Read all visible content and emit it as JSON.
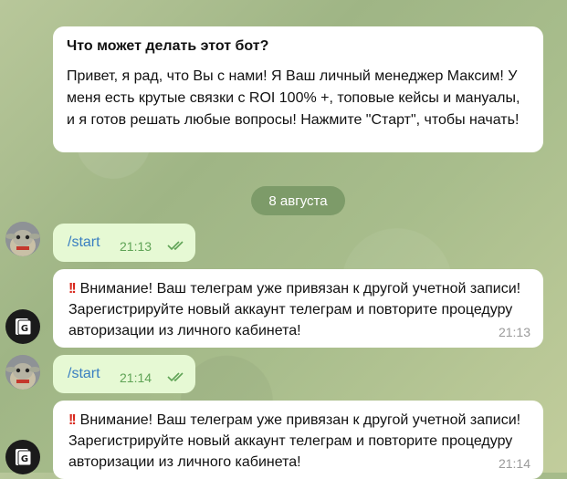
{
  "bot_info": {
    "title": "Что может делать этот бот?",
    "text": "Привет, я рад, что Вы с нами! Я Ваш личный менеджер Максим! У меня есть крутые связки с ROI 100% +, топовые кейсы и мануалы, и я готов решать любые вопросы! Нажмите \"Старт\", чтобы начать!"
  },
  "date_separator": "8 августа",
  "messages": [
    {
      "from": "user",
      "text": "/start",
      "time": "21:13",
      "status": "read"
    },
    {
      "from": "bot",
      "icon": "double-exclamation-icon",
      "text": "Внимание! Ваш телеграм уже привязан к другой учетной записи! Зарегистрируйте новый аккаунт телеграм и повторите процедуру авторизации из личного кабинета!",
      "time": "21:13"
    },
    {
      "from": "user",
      "text": "/start",
      "time": "21:14",
      "status": "read"
    },
    {
      "from": "bot",
      "icon": "double-exclamation-icon",
      "text": "Внимание! Ваш телеграм уже привязан к другой учетной записи! Зарегистрируйте новый аккаунт телеграм и повторите процедуру авторизации из личного кабинета!",
      "time": "21:14"
    }
  ],
  "colors": {
    "outgoing_bubble": "#e6f9d4",
    "incoming_bubble": "#ffffff",
    "date_pill": "#7d9b69",
    "check_marks": "#5fa356"
  }
}
